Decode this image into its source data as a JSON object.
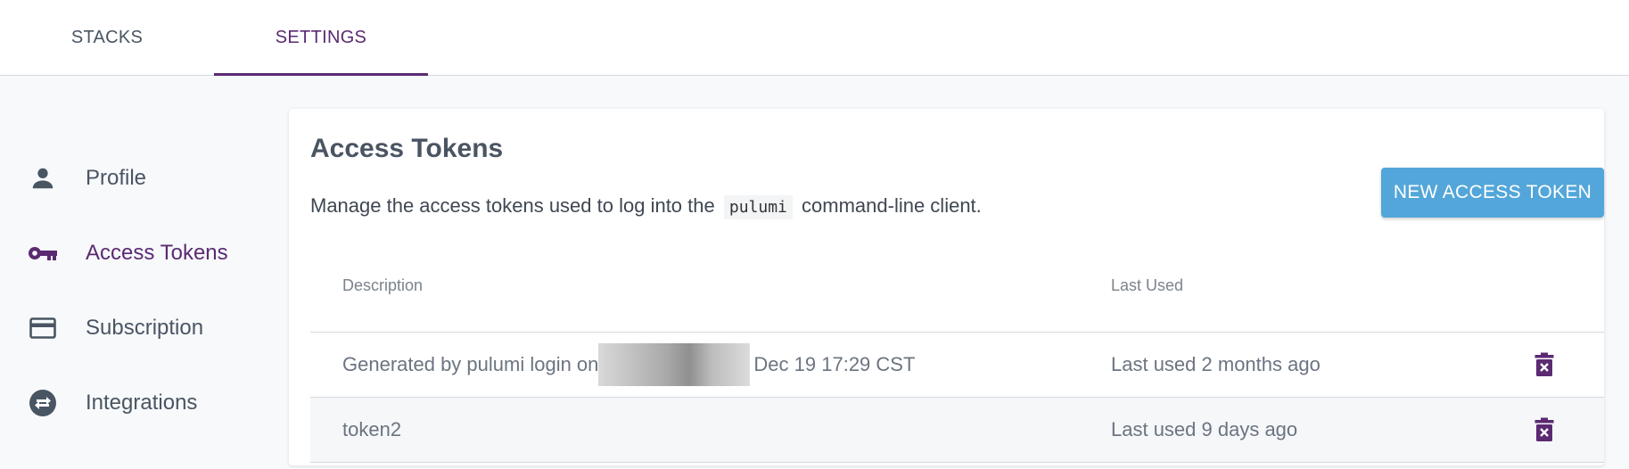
{
  "tabs": [
    {
      "label": "STACKS",
      "active": false
    },
    {
      "label": "SETTINGS",
      "active": true
    }
  ],
  "sidebar": {
    "items": [
      {
        "label": "Profile",
        "icon": "person-icon",
        "active": false
      },
      {
        "label": "Access Tokens",
        "icon": "key-icon",
        "active": true
      },
      {
        "label": "Subscription",
        "icon": "credit-card-icon",
        "active": false
      },
      {
        "label": "Integrations",
        "icon": "swap-arrows-icon",
        "active": false
      }
    ]
  },
  "main": {
    "title": "Access Tokens",
    "description_before": "Manage the access tokens used to log into the",
    "description_code": "pulumi",
    "description_after": "command-line client.",
    "new_button_label": "NEW ACCESS TOKEN",
    "table": {
      "columns": [
        "Description",
        "Last Used"
      ],
      "rows": [
        {
          "description_before": "Generated by pulumi login on",
          "description_after": "Dec 19 17:29 CST",
          "redacted": true,
          "last_used": "Last used 2 months ago"
        },
        {
          "description_before": "token2",
          "description_after": "",
          "redacted": false,
          "last_used": "Last used 9 days ago"
        }
      ]
    }
  },
  "colors": {
    "accent_purple": "#5b2a72",
    "button_blue": "#53a6d9",
    "background": "#f7f9fb"
  }
}
